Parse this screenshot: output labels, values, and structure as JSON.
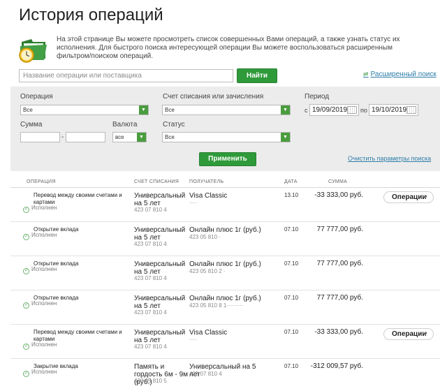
{
  "page": {
    "title": "История операций",
    "intro": "На этой странице Вы можете просмотреть список совершенных Вами операций, а также узнать статус их исполнения. Для быстрого поиска интересующей операции Вы можете воспользоваться расширенным фильтром/поиском операций."
  },
  "search": {
    "placeholder": "Название операции или поставщика",
    "find_label": "Найти",
    "advanced_label": "Расширенный поиск"
  },
  "filter": {
    "operation_label": "Операция",
    "operation_value": "Все",
    "account_label": "Счет списания или зачисления",
    "account_value": "Все",
    "period_label": "Период",
    "from_prefix": "с",
    "date_from": "19/09/2019",
    "to_prefix": "по",
    "date_to": "19/10/2019",
    "sum_label": "Сумма",
    "sum_separator": "-",
    "currency_label": "Валюта",
    "currency_value": "все",
    "status_label": "Статус",
    "status_value": "Все",
    "apply_label": "Применить",
    "clear_label": "Очистить параметры поиска"
  },
  "table": {
    "columns": [
      "ОПЕРАЦИЯ",
      "СЧЕТ СПИСАНИЯ",
      "ПОЛУЧАТЕЛЬ",
      "ДАТА",
      "СУММА"
    ],
    "rows": [
      {
        "operation": "Перевод между своими счетами и картами",
        "status": "Исполнен",
        "account": "Универсальный на 5 лет",
        "account_num": "423 07 810 4",
        "recipient": "Visa Classic",
        "recipient_num": "····",
        "date": "13.10",
        "amount": "-33 333,00 руб.",
        "action": "Операции"
      },
      {
        "operation": "Открытие вклада",
        "status": "Исполнен",
        "account": "Универсальный на 5 лет",
        "account_num": "423 07 810 4",
        "recipient": "Онлайн плюс 1г (руб.)",
        "recipient_num": "423 05 810 ·",
        "date": "07.10",
        "amount": "77 777,00 руб."
      },
      {
        "operation": "Открытие вклада",
        "status": "Исполнен",
        "account": "Универсальный на 5 лет",
        "account_num": "423 07 810 4",
        "recipient": "Онлайн плюс 1г (руб.)",
        "recipient_num": "423 05 810 2 ·",
        "date": "07.10",
        "amount": "77 777,00 руб."
      },
      {
        "operation": "Открытие вклада",
        "status": "Исполнен",
        "account": "Универсальный на 5 лет",
        "account_num": "423 07 810 4",
        "recipient": "Онлайн плюс 1г (руб.)",
        "recipient_num": "423 05 810 8 1·········",
        "date": "07.10",
        "amount": "77 777,00 руб."
      },
      {
        "operation": "Перевод между своими счетами и картами",
        "status": "Исполнен",
        "account": "Универсальный на 5 лет",
        "account_num": "423 07 810 4",
        "recipient": "Visa Classic",
        "recipient_num": "····",
        "date": "07.10",
        "amount": "-33 333,00 руб.",
        "action": "Операции"
      },
      {
        "operation": "Закрытие вклада",
        "status": "Исполнен",
        "account": "Память и гордость 6м - 9м (руб.)",
        "account_num": "423 05 810 5",
        "recipient": "Универсальный на 5 лет",
        "recipient_num": "423 07 810 4",
        "date": "07.10",
        "amount": "-312 009,57 руб."
      }
    ]
  }
}
